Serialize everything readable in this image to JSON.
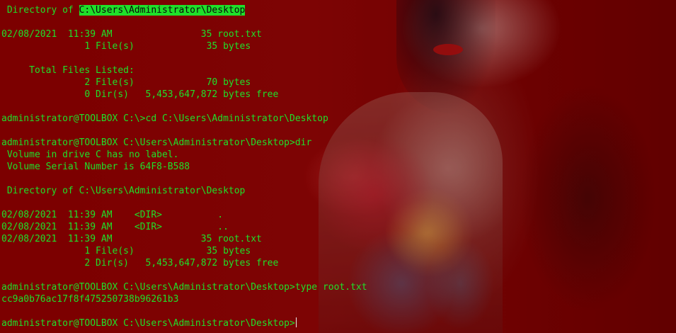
{
  "colors": {
    "terminal_text": "#1fe02a",
    "highlight_bg": "#1fe02a",
    "background": "#7a0000"
  },
  "terminal": {
    "lines": [
      {
        "prefix": " Directory of ",
        "highlight": "C:\\Users\\Administrator\\Desktop"
      },
      "",
      "02/08/2021  11:39 AM                35 root.txt",
      "               1 File(s)             35 bytes",
      "",
      "     Total Files Listed:",
      "               2 File(s)             70 bytes",
      "               0 Dir(s)   5,453,647,872 bytes free",
      "",
      "administrator@TOOLBOX C:\\>cd C:\\Users\\Administrator\\Desktop",
      "",
      "administrator@TOOLBOX C:\\Users\\Administrator\\Desktop>dir",
      " Volume in drive C has no label.",
      " Volume Serial Number is 64F8-B588",
      "",
      " Directory of C:\\Users\\Administrator\\Desktop",
      "",
      "02/08/2021  11:39 AM    <DIR>          .",
      "02/08/2021  11:39 AM    <DIR>          ..",
      "02/08/2021  11:39 AM                35 root.txt",
      "               1 File(s)             35 bytes",
      "               2 Dir(s)   5,453,647,872 bytes free",
      "",
      "administrator@TOOLBOX C:\\Users\\Administrator\\Desktop>type root.txt",
      "cc9a0b76ac17f8f475250738b96261b3",
      "",
      "administrator@TOOLBOX C:\\Users\\Administrator\\Desktop>"
    ]
  }
}
